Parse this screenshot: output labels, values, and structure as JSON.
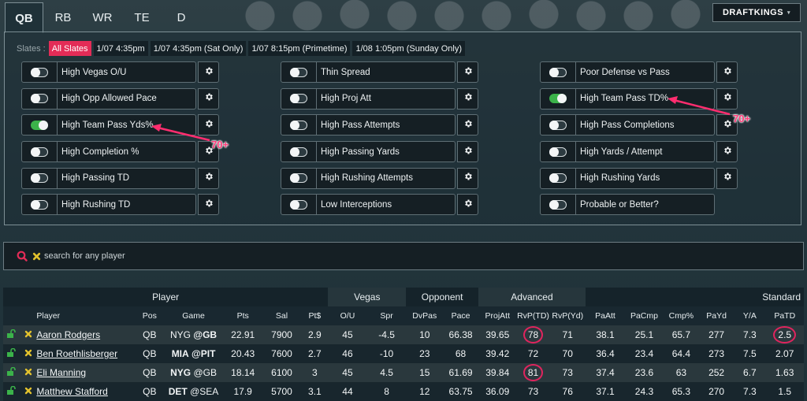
{
  "tabs": [
    "QB",
    "RB",
    "WR",
    "TE",
    "D"
  ],
  "active_tab": "QB",
  "site_selector": {
    "label": "DRAFTKINGS",
    "caret": "▾"
  },
  "slates": {
    "label": "Slates :",
    "items": [
      "All Slates",
      "1/07 4:35pm",
      "1/07 4:35pm (Sat Only)",
      "1/07 8:15pm (Primetime)",
      "1/08 1:05pm (Sunday Only)"
    ],
    "active": "All Slates"
  },
  "filters": {
    "col1": [
      {
        "label": "High Vegas O/U",
        "on": false,
        "gear": true
      },
      {
        "label": "High Opp Allowed Pace",
        "on": false,
        "gear": true
      },
      {
        "label": "High Team Pass Yds%",
        "on": true,
        "gear": true
      },
      {
        "label": "High Completion %",
        "on": false,
        "gear": true
      },
      {
        "label": "High Passing TD",
        "on": false,
        "gear": true
      },
      {
        "label": "High Rushing TD",
        "on": false,
        "gear": true
      }
    ],
    "col2": [
      {
        "label": "Thin Spread",
        "on": false,
        "gear": true
      },
      {
        "label": "High Proj Att",
        "on": false,
        "gear": true
      },
      {
        "label": "High Pass Attempts",
        "on": false,
        "gear": true
      },
      {
        "label": "High Passing Yards",
        "on": false,
        "gear": true
      },
      {
        "label": "High Rushing Attempts",
        "on": false,
        "gear": true
      },
      {
        "label": "Low Interceptions",
        "on": false,
        "gear": true
      }
    ],
    "col3": [
      {
        "label": "Poor Defense vs Pass",
        "on": false,
        "gear": true
      },
      {
        "label": "High Team Pass TD%",
        "on": true,
        "gear": true
      },
      {
        "label": "High Pass Completions",
        "on": false,
        "gear": true
      },
      {
        "label": "High Yards / Attempt",
        "on": false,
        "gear": true
      },
      {
        "label": "High Rushing Yards",
        "on": false,
        "gear": true
      },
      {
        "label": "Probable or Better?",
        "on": false,
        "gear": false
      }
    ]
  },
  "annotations": [
    "70+",
    "70+"
  ],
  "search": {
    "placeholder": "search for any player"
  },
  "table": {
    "groups": [
      {
        "label": "Player",
        "span": 8
      },
      {
        "label": "Vegas",
        "span": 2
      },
      {
        "label": "Opponent",
        "span": 2
      },
      {
        "label": "Advanced",
        "span": 3
      },
      {
        "label": "Standard",
        "span": 6
      }
    ],
    "columns": [
      "",
      "",
      "Player",
      "Pos",
      "Game",
      "Pts",
      "Sal",
      "Pt$",
      "O/U",
      "Spr",
      "DvPas",
      "Pace",
      "ProjAtt",
      "RvP(TD)",
      "RvP(Yd)",
      "PaAtt",
      "PaCmp",
      "Cmp%",
      "PaYd",
      "Y/A",
      "PaTD"
    ],
    "rows": [
      {
        "player": "Aaron Rodgers",
        "pos": "QB",
        "game_away": "NYG",
        "game_home": "@GB",
        "bold": "home",
        "pts": "22.91",
        "sal": "7900",
        "ptd": "2.9",
        "ou": "45",
        "spr": "-4.5",
        "dvpas": "10",
        "pace": "66.38",
        "projatt": "39.65",
        "rvptd": "78",
        "rvpyd": "71",
        "paatt": "38.1",
        "pacmp": "25.1",
        "cmp": "65.7",
        "payd": "277",
        "ya": "7.3",
        "patd": "2.5",
        "circled": [
          "rvptd",
          "patd"
        ]
      },
      {
        "player": "Ben Roethlisberger",
        "pos": "QB",
        "game_away": "MIA",
        "game_home": "@PIT",
        "bold": "both",
        "pts": "20.43",
        "sal": "7600",
        "ptd": "2.7",
        "ou": "46",
        "spr": "-10",
        "dvpas": "23",
        "pace": "68",
        "projatt": "39.42",
        "rvptd": "72",
        "rvpyd": "70",
        "paatt": "36.4",
        "pacmp": "23.4",
        "cmp": "64.4",
        "payd": "273",
        "ya": "7.5",
        "patd": "2.07",
        "circled": []
      },
      {
        "player": "Eli Manning",
        "pos": "QB",
        "game_away": "NYG",
        "game_home": "@GB",
        "bold": "away",
        "pts": "18.14",
        "sal": "6100",
        "ptd": "3",
        "ou": "45",
        "spr": "4.5",
        "dvpas": "15",
        "pace": "61.69",
        "projatt": "39.84",
        "rvptd": "81",
        "rvpyd": "73",
        "paatt": "37.4",
        "pacmp": "23.6",
        "cmp": "63",
        "payd": "252",
        "ya": "6.7",
        "patd": "1.63",
        "circled": [
          "rvptd"
        ]
      },
      {
        "player": "Matthew Stafford",
        "pos": "QB",
        "game_away": "DET",
        "game_home": "@SEA",
        "bold": "away",
        "pts": "17.9",
        "sal": "5700",
        "ptd": "3.1",
        "ou": "44",
        "spr": "8",
        "dvpas": "12",
        "pace": "63.75",
        "projatt": "36.09",
        "rvptd": "73",
        "rvpyd": "76",
        "paatt": "37.1",
        "pacmp": "24.3",
        "cmp": "65.3",
        "payd": "270",
        "ya": "7.3",
        "patd": "1.5",
        "circled": []
      }
    ]
  },
  "colors": {
    "accent": "#e32c57",
    "toggle_on": "#3bb34a",
    "lock": "#3bb34a",
    "remove_x": "#e2c22d",
    "annotation": "#ff3c7a"
  }
}
